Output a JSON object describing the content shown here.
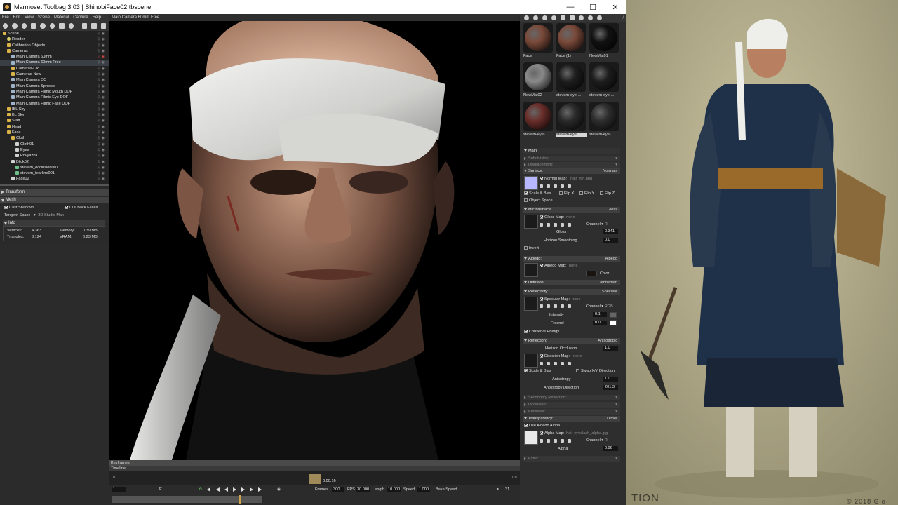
{
  "window": {
    "title": "Marmoset Toolbag 3.03  |  ShinobiFace02.tbscene",
    "minimize_glyph": "—",
    "maximize_glyph": "☐",
    "close_glyph": "✕"
  },
  "menu": [
    "File",
    "Edit",
    "View",
    "Scene",
    "Material",
    "Capture",
    "Help"
  ],
  "scene_tree": [
    {
      "label": "Scene",
      "indent": 0,
      "kind": "folder"
    },
    {
      "label": "Render",
      "indent": 1,
      "kind": "light"
    },
    {
      "label": "Calibration Objects",
      "indent": 1,
      "kind": "folder"
    },
    {
      "label": "Cameras",
      "indent": 1,
      "kind": "folder"
    },
    {
      "label": "Main Camera 60mm",
      "indent": 2,
      "kind": "cam",
      "flag": "red"
    },
    {
      "label": "Main Camera 60mm Free",
      "indent": 2,
      "kind": "cam"
    },
    {
      "label": "Cameras-Old",
      "indent": 2,
      "kind": "folder"
    },
    {
      "label": "Cameras-New",
      "indent": 2,
      "kind": "folder"
    },
    {
      "label": "Main Camera CC",
      "indent": 2,
      "kind": "cam"
    },
    {
      "label": "Main Camera Spheres",
      "indent": 2,
      "kind": "cam"
    },
    {
      "label": "Main Camera Filmic Mouth DOF",
      "indent": 2,
      "kind": "cam"
    },
    {
      "label": "Main Camera Filmic Eye DOF",
      "indent": 2,
      "kind": "cam"
    },
    {
      "label": "Main Camera Filmic Face DOF",
      "indent": 2,
      "kind": "cam"
    },
    {
      "label": "IBL Sky",
      "indent": 1,
      "kind": "folder"
    },
    {
      "label": "BL Sky",
      "indent": 1,
      "kind": "folder"
    },
    {
      "label": "Staff",
      "indent": 1,
      "kind": "folder"
    },
    {
      "label": "Head",
      "indent": 1,
      "kind": "folder"
    },
    {
      "label": "Face",
      "indent": 1,
      "kind": "folder"
    },
    {
      "label": "Cloth",
      "indent": 2,
      "kind": "folder"
    },
    {
      "label": "Cloth01",
      "indent": 3,
      "kind": "mat"
    },
    {
      "label": "Eyes",
      "indent": 3,
      "kind": "mat"
    },
    {
      "label": "Povyazka",
      "indent": 3,
      "kind": "mat"
    },
    {
      "label": "Blick02",
      "indent": 2,
      "kind": "mat"
    },
    {
      "label": "stevem_occlusion001",
      "indent": 3,
      "kind": "mesh"
    },
    {
      "label": "stevem_tearline001",
      "indent": 3,
      "kind": "mesh"
    },
    {
      "label": "Face02",
      "indent": 2,
      "kind": "mat"
    }
  ],
  "left_panel": {
    "transform_label": "Transform",
    "mesh_label": "Mesh",
    "cast_shadows": "Cast Shadows",
    "cull_back_faces": "Cull Back Faces",
    "tangent_space_label": "Tangent Space",
    "tangent_space_value": "3D Studio Max",
    "info_label": "Info",
    "vertices_label": "Vertices:",
    "vertices_value": "4,363",
    "triangles_label": "Triangles:",
    "triangles_value": "8,124",
    "memory_label": "Memory:",
    "memory_value": "0.39 MB",
    "vram_label": "VRAM:",
    "vram_value": "0.23 MB"
  },
  "viewport": {
    "tab": "Main Camera 60mm Free"
  },
  "timeline": {
    "keyframes_label": "Keyframes",
    "timeline_label": "Timeline",
    "start_tick": "0s",
    "end_tick": "10s",
    "current_time": "0:00.16",
    "frame_field": "1",
    "frames_label": "Frames",
    "frames_value": "300",
    "fps_label": "FPS",
    "fps_value": "30.000",
    "length_label": "Length",
    "length_value": "10.000",
    "speed_label": "Speed",
    "speed_value": "1.000",
    "bake_speed": "Bake Speed",
    "count": "31"
  },
  "materials": {
    "version": "/",
    "swatches": [
      {
        "label": "Face",
        "color": "#7a4a3a"
      },
      {
        "label": "Face (1)",
        "color": "#7a4a3a"
      },
      {
        "label": "NewMat01",
        "color": "#111111"
      },
      {
        "label": "NewMat02",
        "color": "#8a8a8a"
      },
      {
        "label": "stevem-eye-...",
        "color": "#1e1e1e"
      },
      {
        "label": "stevem-eye-...",
        "color": "#1e1e1e"
      },
      {
        "label": "stevem-eye-...",
        "color": "#6a2e2a"
      },
      {
        "label": "stevem-eyel...",
        "color": "#2a2a2a",
        "selected": true
      },
      {
        "label": "stevem-eye-...",
        "color": "#2e2e2e"
      }
    ]
  },
  "props": {
    "main": "Main",
    "subdivision": "Subdivision:",
    "displacement": "Displacement:",
    "surface": "Surface:",
    "surface_mode": "Normals",
    "normal_map": "Normal Map:",
    "normal_map_file": "hair_nm.png",
    "scale_bias": "Scale & Bias",
    "flip_x": "Flip X",
    "flip_y": "Flip Y",
    "flip_z": "Flip Z",
    "object_space": "Object Space",
    "microsurface": "Microsurface:",
    "microsurface_mode": "Gloss",
    "gloss_map": "Gloss Map:",
    "none": "none",
    "channel": "Channel",
    "channel_r": "R",
    "channel_rgb": "RGB",
    "gloss": "Gloss",
    "gloss_value": "0.341",
    "horizon_smoothing": "Horizon Smoothing",
    "horizon_smoothing_value": "0.0",
    "invert": "Invert",
    "albedo": "Albedo:",
    "albedo_mode": "Albedo",
    "albedo_map": "Albedo Map:",
    "color": "Color",
    "diffusion": "Diffusion:",
    "diffusion_mode": "Lambertian",
    "reflectivity": "Reflectivity:",
    "reflectivity_mode": "Specular",
    "specular_map": "Specular Map:",
    "intensity": "Intensity",
    "intensity_value": "0.1",
    "fresnel": "Fresnel",
    "fresnel_value": "0.0",
    "conserve_energy": "Conserve Energy",
    "reflection": "Reflection:",
    "reflection_mode": "Anisotropic",
    "horizon_occlusion": "Horizon Occlusion",
    "horizon_occlusion_value": "1.0",
    "direction_map": "Direction Map:",
    "swap_xy": "Swap X/Y Direction",
    "anisotropy": "Anisotropy",
    "anisotropy_value": "1.0",
    "anisotropy_direction": "Anisotropy Direction",
    "anisotropy_direction_value": "201.3",
    "secondary_reflection": "Secondary Reflection:",
    "occlusion": "Occlusion:",
    "emissive": "Emissive:",
    "transparency": "Transparency:",
    "transparency_mode": "Dither",
    "use_albedo_alpha": "Use Albedo Alpha",
    "alpha_map": "Alpha Map:",
    "alpha_map_file": "hair-eyeslash_alpha.jpg",
    "alpha": "Alpha",
    "alpha_value": "0.96",
    "extra": "Extra:"
  },
  "art": {
    "label": "TION",
    "copyright": "© 2018 Gio"
  },
  "colors": {
    "accent": "#c9a24a",
    "panel": "#2e2e2e",
    "field": "#151515"
  }
}
